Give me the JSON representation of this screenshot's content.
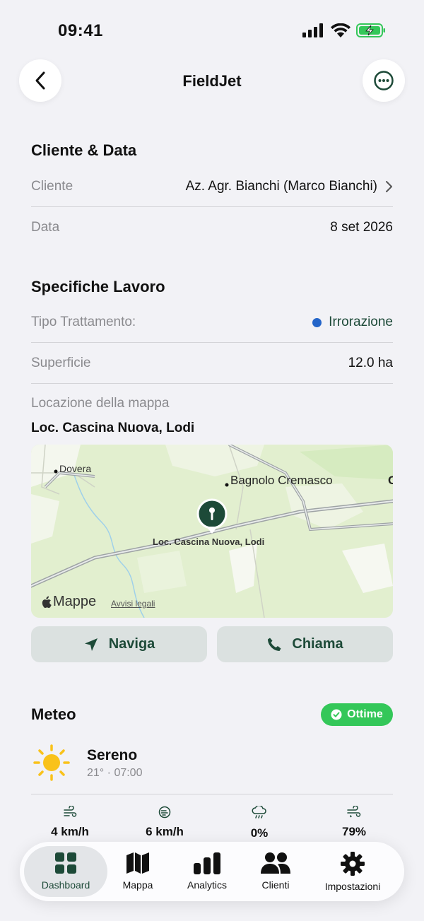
{
  "status_bar": {
    "time": "09:41"
  },
  "header": {
    "title": "FieldJet"
  },
  "client_section": {
    "title": "Cliente & Data",
    "client_label": "Cliente",
    "client_value": "Az. Agr. Bianchi (Marco Bianchi)",
    "date_label": "Data",
    "date_value": "8 set 2026"
  },
  "job_section": {
    "title": "Specifiche Lavoro",
    "treatment_label": "Tipo Trattamento:",
    "treatment_value": "Irrorazione",
    "treatment_color": "#2465c9",
    "area_label": "Superficie",
    "area_value": "12.0 ha",
    "location_label": "Locazione della mappa",
    "location_value": "Loc. Cascina Nuova, Lodi"
  },
  "map": {
    "place_dovera": "Dovera",
    "place_bagnolo": "Bagnolo Cremasco",
    "place_edge": "C",
    "pin_label": "Loc. Cascina Nuova, Lodi",
    "brand": "Mappe",
    "legal": "Avvisi legali"
  },
  "actions": {
    "navigate_label": "Naviga",
    "navigate_icon": "navigation-arrow-icon",
    "call_label": "Chiama",
    "call_icon": "phone-icon"
  },
  "weather": {
    "title": "Meteo",
    "badge": "Ottime",
    "badge_color": "#34c759",
    "condition": "Sereno",
    "temperature": "21°",
    "time": "07:00",
    "stats": [
      {
        "icon": "wind-icon",
        "value": "4 km/h"
      },
      {
        "icon": "gust-icon",
        "value": "6 km/h"
      },
      {
        "icon": "rain-cloud-icon",
        "value": "0%"
      },
      {
        "icon": "humidity-icon",
        "value": "79%"
      }
    ]
  },
  "tabbar": {
    "tabs": [
      {
        "label": "Dashboard",
        "icon": "dashboard-grid-icon",
        "active": true
      },
      {
        "label": "Mappa",
        "icon": "map-icon",
        "active": false
      },
      {
        "label": "Analytics",
        "icon": "bar-chart-icon",
        "active": false
      },
      {
        "label": "Clienti",
        "icon": "people-icon",
        "active": false
      },
      {
        "label": "Impostazioni",
        "icon": "gear-icon",
        "active": false
      }
    ]
  },
  "colors": {
    "accent": "#1d4a38",
    "background": "#f2f2f6"
  }
}
